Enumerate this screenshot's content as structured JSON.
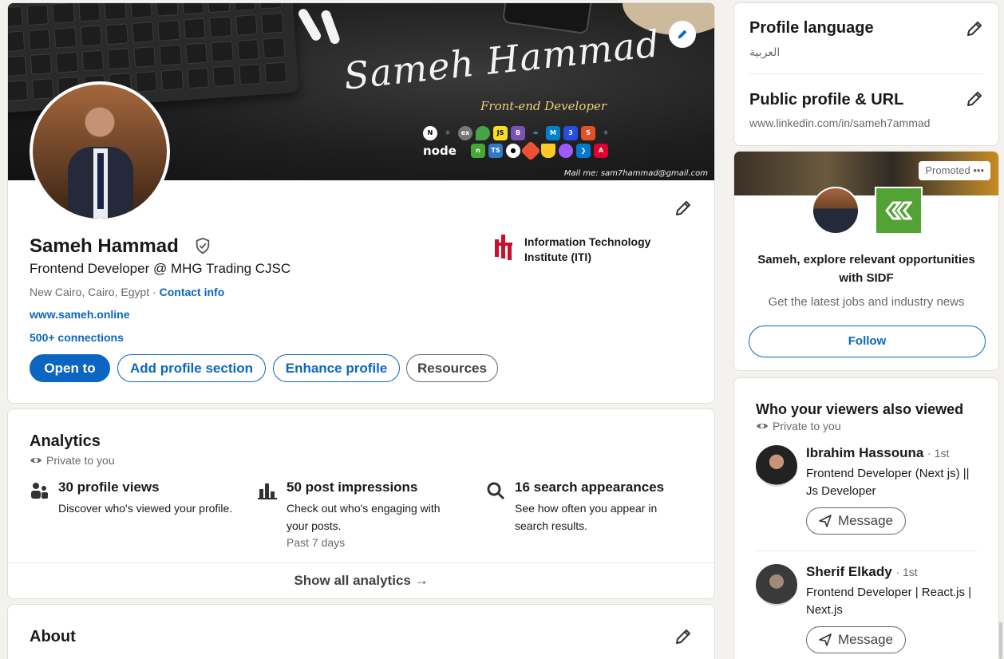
{
  "profile": {
    "name": "Sameh Hammad",
    "headline": "Frontend Developer @ MHG Trading CJSC",
    "location": "New Cairo, Cairo, Egypt ·",
    "contact_label": "Contact info",
    "website": "www.sameh.online",
    "connections": "500+ connections",
    "education": "Information Technology Institute (ITI)",
    "actions": {
      "open_to": "Open to",
      "add_section": "Add profile section",
      "enhance": "Enhance profile",
      "resources": "Resources"
    }
  },
  "banner": {
    "signature": "Sameh Hammad",
    "role": "Front-end Developer",
    "mail": "Mail me: sam7hammad@gmail.com",
    "tech_logos": [
      "N",
      "ex",
      "JS",
      "B",
      "TS",
      "node",
      "5",
      "3"
    ]
  },
  "analytics": {
    "title": "Analytics",
    "privacy": "Private to you",
    "stats": [
      {
        "title": "30 profile views",
        "desc": "Discover who's viewed your profile.",
        "icon": "people-icon"
      },
      {
        "title": "50 post impressions",
        "desc": "Check out who's engaging with your posts.",
        "period": "Past 7 days",
        "icon": "bar-chart-icon"
      },
      {
        "title": "16 search appearances",
        "desc": "See how often you appear in search results.",
        "icon": "search-icon"
      }
    ],
    "show_all": "Show all analytics →"
  },
  "about": {
    "title": "About"
  },
  "sidebar": {
    "language_title": "Profile language",
    "language_value": "العربية",
    "url_title": "Public profile & URL",
    "url_value": "www.linkedin.com/in/sameh7ammad"
  },
  "promo": {
    "tag": "Promoted",
    "text": "Sameh, explore relevant opportunities with SIDF",
    "sub": "Get the latest jobs and industry news",
    "follow": "Follow"
  },
  "viewers": {
    "title": "Who your viewers also viewed",
    "privacy": "Private to you",
    "people": [
      {
        "name": "Ibrahim Hassouna",
        "degree": "· 1st",
        "headline": "Frontend Developer (Next js) || Js Developer",
        "action": "Message"
      },
      {
        "name": "Sherif Elkady",
        "degree": "· 1st",
        "headline": "Frontend Developer | React.js | Next.js",
        "action": "Message"
      }
    ]
  },
  "colors": {
    "brand": "#0a66c2",
    "background": "#f4f2ee",
    "promo_logo": "#52a234",
    "iti": "#c8102e"
  }
}
